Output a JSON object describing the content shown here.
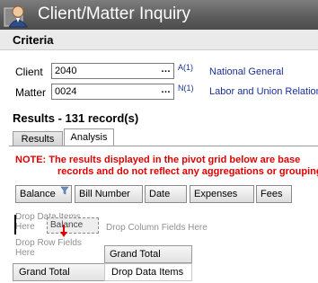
{
  "window": {
    "title": "Client/Matter Inquiry",
    "icon": "person-icon"
  },
  "criteria": {
    "heading": "Criteria",
    "client": {
      "label": "Client",
      "value": "2040",
      "lookup": "…",
      "sup": "A(1)",
      "description": "National General"
    },
    "matter": {
      "label": "Matter",
      "value": "0024",
      "lookup": "…",
      "sup": "N(1)",
      "description": "Labor and Union Relation"
    }
  },
  "results": {
    "heading": "Results - 131 record(s)",
    "tabs": [
      {
        "label": "Results",
        "active": false
      },
      {
        "label": "Analysis",
        "active": true
      }
    ]
  },
  "analysis": {
    "note_line1": "NOTE:  The results displayed in the pivot grid below are base",
    "note_line2": "records and do not reflect any aggregations or groupings",
    "fields": [
      "Balance",
      "Bill Number",
      "Date",
      "Expenses",
      "Fees"
    ],
    "filter_icon": "filter-icon",
    "drop_data_items": "Drop Data Items Here",
    "drag_ghost": "Balance",
    "drop_column_fields": "Drop Column Fields Here",
    "drop_row_fields": "Drop Row Fields Here",
    "drag_arrow_icon": "arrow-down-icon",
    "grid": {
      "column_header": "Grand Total",
      "row_header": "Grand Total",
      "data_cell": "Drop Data Items"
    }
  },
  "colors": {
    "title_bar": "#5b5b5b",
    "note": "#e00000",
    "link_text": "#1a2f9a",
    "drop_hint": "#909090"
  }
}
